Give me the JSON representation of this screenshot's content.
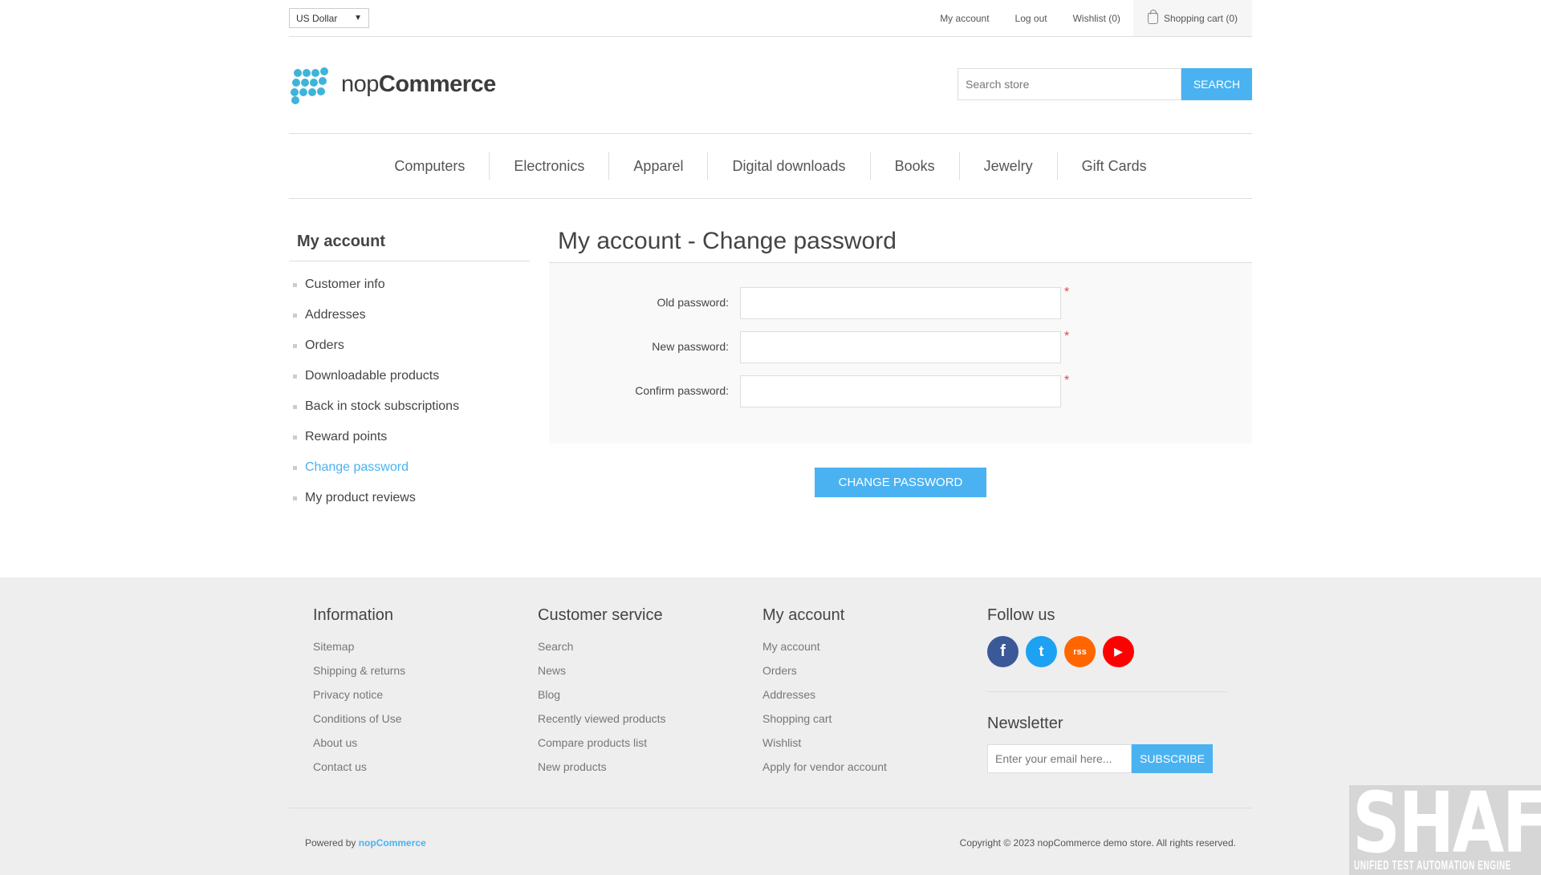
{
  "header": {
    "currency": "US Dollar",
    "links": {
      "my_account": "My account",
      "log_out": "Log out",
      "wishlist": "Wishlist (0)",
      "cart": "Shopping cart (0)"
    },
    "logo": {
      "light": "nop",
      "bold": "Commerce"
    },
    "search": {
      "placeholder": "Search store",
      "button": "SEARCH"
    }
  },
  "nav": [
    "Computers",
    "Electronics",
    "Apparel",
    "Digital downloads",
    "Books",
    "Jewelry",
    "Gift Cards"
  ],
  "sidebar": {
    "title": "My account",
    "items": [
      "Customer info",
      "Addresses",
      "Orders",
      "Downloadable products",
      "Back in stock subscriptions",
      "Reward points",
      "Change password",
      "My product reviews"
    ],
    "active_index": 6
  },
  "main": {
    "title": "My account - Change password",
    "fields": {
      "old": "Old password:",
      "new": "New password:",
      "confirm": "Confirm password:"
    },
    "required_mark": "*",
    "button": "CHANGE PASSWORD"
  },
  "footer": {
    "information": {
      "title": "Information",
      "items": [
        "Sitemap",
        "Shipping & returns",
        "Privacy notice",
        "Conditions of Use",
        "About us",
        "Contact us"
      ]
    },
    "customer_service": {
      "title": "Customer service",
      "items": [
        "Search",
        "News",
        "Blog",
        "Recently viewed products",
        "Compare products list",
        "New products"
      ]
    },
    "my_account": {
      "title": "My account",
      "items": [
        "My account",
        "Orders",
        "Addresses",
        "Shopping cart",
        "Wishlist",
        "Apply for vendor account"
      ]
    },
    "follow": {
      "title": "Follow us",
      "icons": {
        "facebook": "f",
        "twitter": "t",
        "rss": "rss",
        "youtube": "▶"
      }
    },
    "newsletter": {
      "title": "Newsletter",
      "placeholder": "Enter your email here...",
      "button": "SUBSCRIBE"
    },
    "powered_by": "Powered by",
    "powered_link": "nopCommerce",
    "copyright": "Copyright © 2023 nopCommerce demo store. All rights reserved."
  },
  "watermark": {
    "title": "SHAFT",
    "subtitle": "UNIFIED TEST AUTOMATION ENGINE"
  },
  "colors": {
    "accent": "#4ab2f1",
    "logo": "#3fb4d9",
    "required": "#e4444c",
    "facebook": "#3b5998",
    "twitter": "#1da1f2",
    "rss": "#ff6600",
    "youtube": "#ff0000"
  }
}
